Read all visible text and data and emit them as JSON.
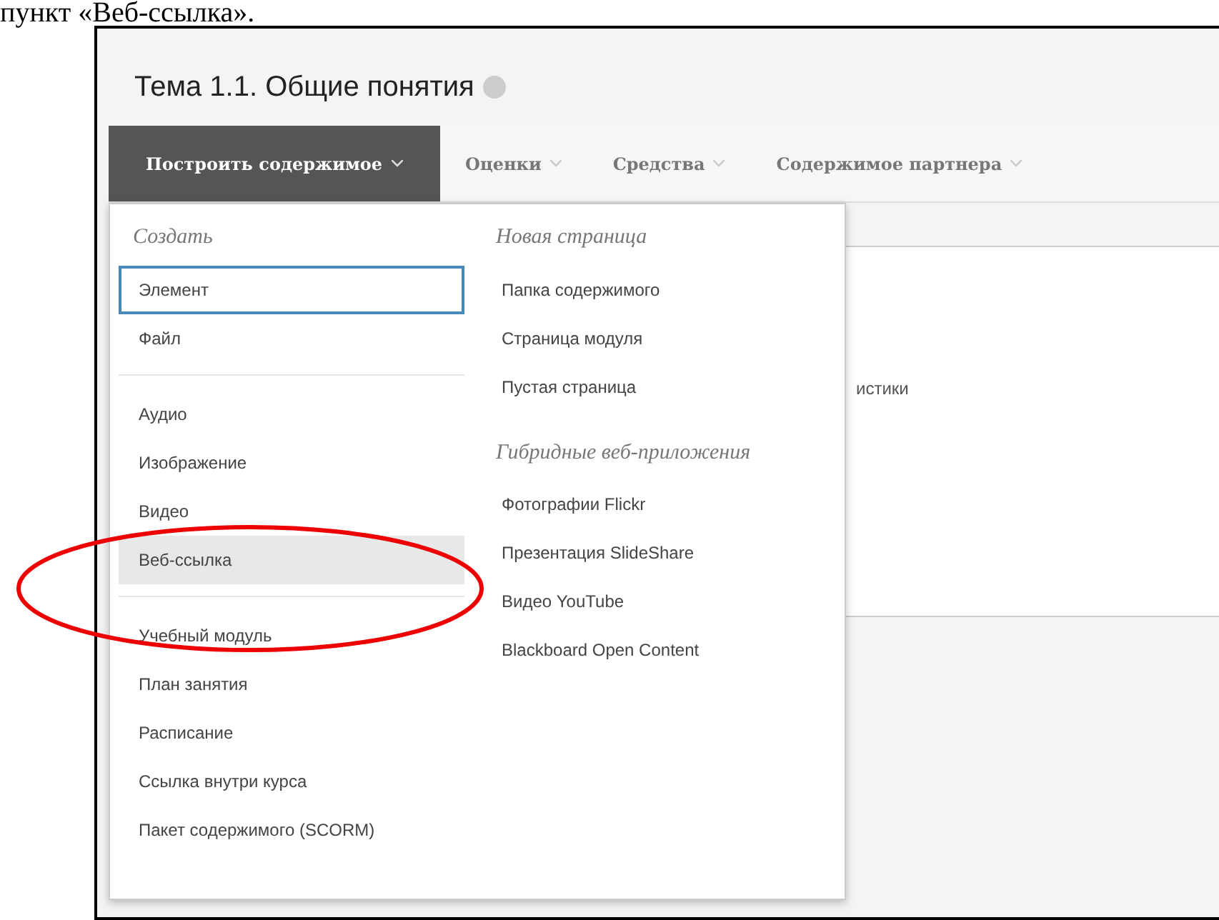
{
  "caption": "пункт «Веб-ссылка».",
  "page_title": "Тема 1.1. Общие понятия",
  "tabs": [
    {
      "label": "Построить содержимое",
      "selected": true
    },
    {
      "label": "Оценки",
      "selected": false
    },
    {
      "label": "Средства",
      "selected": false
    },
    {
      "label": "Содержимое партнера",
      "selected": false
    }
  ],
  "menu": {
    "left": {
      "heading": "Создать",
      "groups": [
        [
          {
            "label": "Элемент",
            "focused": true,
            "highlighted": false
          },
          {
            "label": "Файл",
            "focused": false,
            "highlighted": false
          }
        ],
        [
          {
            "label": "Аудио",
            "focused": false,
            "highlighted": false
          },
          {
            "label": "Изображение",
            "focused": false,
            "highlighted": false
          },
          {
            "label": "Видео",
            "focused": false,
            "highlighted": false
          },
          {
            "label": "Веб-ссылка",
            "focused": false,
            "highlighted": true
          }
        ],
        [
          {
            "label": "Учебный модуль",
            "focused": false,
            "highlighted": false
          },
          {
            "label": "План занятия",
            "focused": false,
            "highlighted": false
          },
          {
            "label": "Расписание",
            "focused": false,
            "highlighted": false
          },
          {
            "label": "Ссылка внутри курса",
            "focused": false,
            "highlighted": false
          },
          {
            "label": "Пакет содержимого (SCORM)",
            "focused": false,
            "highlighted": false
          }
        ]
      ]
    },
    "right": [
      {
        "heading": "Новая страница",
        "items": [
          "Папка содержимого",
          "Страница модуля",
          "Пустая страница"
        ]
      },
      {
        "heading": "Гибридные веб-приложения",
        "items": [
          "Фотографии Flickr",
          "Презентация SlideShare",
          "Видео YouTube",
          "Blackboard Open Content"
        ]
      }
    ]
  },
  "background_text": "истики"
}
